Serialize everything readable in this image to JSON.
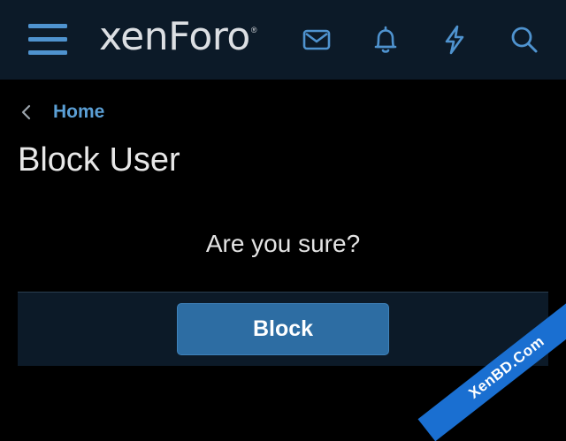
{
  "header": {
    "logo_text": "xenForo",
    "logo_mark": "®",
    "icons": [
      "menu-icon",
      "envelope-icon",
      "bell-icon",
      "bolt-icon",
      "search-icon"
    ]
  },
  "breadcrumb": {
    "home_label": "Home"
  },
  "page": {
    "title": "Block User",
    "confirm_text": "Are you sure?",
    "submit_label": "Block"
  },
  "watermark": {
    "text": "XenBD.Com"
  },
  "colors": {
    "header_bg": "#0c1a28",
    "page_bg": "#000000",
    "accent": "#2d6da3",
    "link": "#5b9fd5",
    "icon": "#4f93cf",
    "watermark_bg": "#1a6fd1"
  }
}
